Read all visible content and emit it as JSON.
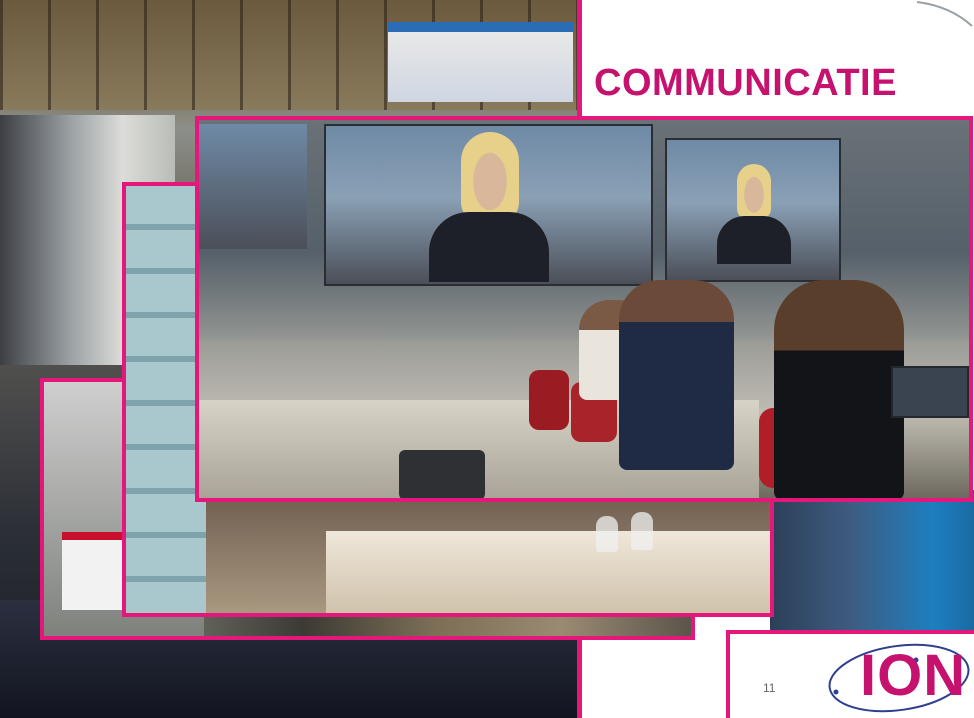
{
  "slide": {
    "title": "COMMUNICATIE",
    "page_number": "11"
  },
  "logo": {
    "text": "ION"
  },
  "colors": {
    "accent_pink": "#e5177b",
    "title_pink": "#c5126e"
  }
}
